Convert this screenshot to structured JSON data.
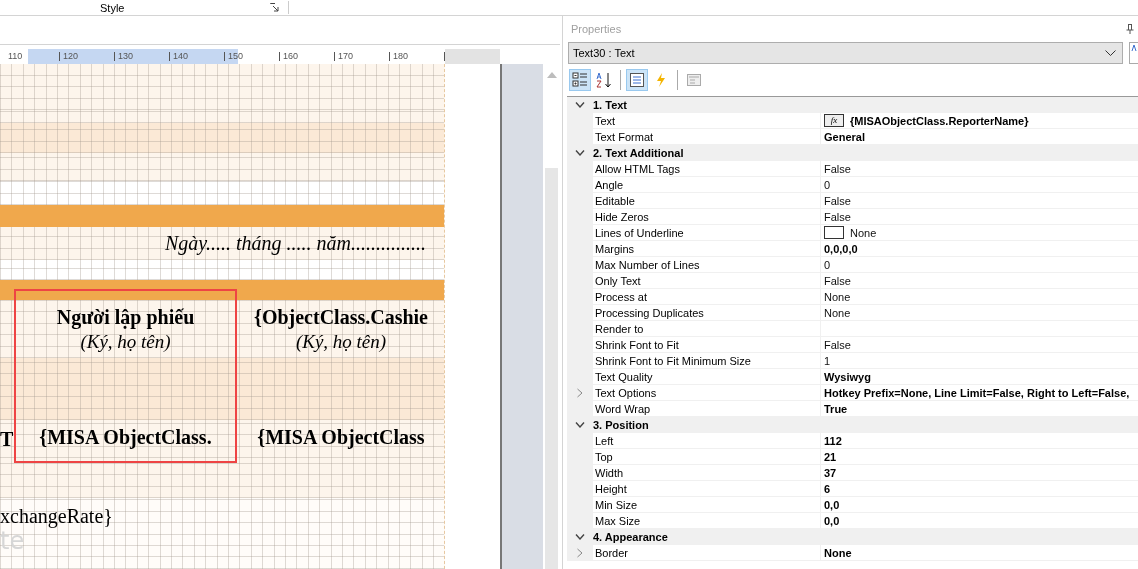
{
  "ribbon": {
    "group_label": "Style"
  },
  "ruler": {
    "ticks": [
      "110",
      "120",
      "130",
      "140",
      "150",
      "160",
      "170",
      "180"
    ]
  },
  "report": {
    "date_line": "Ngày..... tháng ..... năm...............",
    "signatures": [
      {
        "title": "Người lập phiếu",
        "note": "(Ký, họ tên)",
        "field": "{MISA ObjectClass.",
        "selected": true
      },
      {
        "title": "{ObjectClass.Cashie",
        "note": "(Ký, họ tên)",
        "field": "{MISA ObjectClass",
        "selected": false
      }
    ],
    "left_field": "T",
    "exchange_rate": "xchangeRate}",
    "faded_label": "te"
  },
  "properties": {
    "title": "Properties",
    "object_selector": "Text30 : Text",
    "toolbar": [
      {
        "kind": "categorized",
        "selected": true
      },
      {
        "kind": "alphabetical",
        "selected": false
      },
      {
        "kind": "separator"
      },
      {
        "kind": "properties",
        "selected": true
      },
      {
        "kind": "events",
        "selected": false
      },
      {
        "kind": "separator"
      },
      {
        "kind": "pages",
        "selected": false
      }
    ],
    "categories": [
      {
        "name": "1. Text",
        "expanded": true,
        "rows": [
          {
            "name": "Text",
            "value": "{MISAObjectClass.ReporterName}",
            "modified": true,
            "kind": "expression",
            "button_label": "fx",
            "expandable": false
          },
          {
            "name": "Text Format",
            "value": "General",
            "modified": true,
            "kind": "plain",
            "expandable": false
          }
        ]
      },
      {
        "name": "2. Text  Additional",
        "expanded": true,
        "rows": [
          {
            "name": "Allow HTML Tags",
            "value": "False",
            "modified": false,
            "kind": "plain",
            "expandable": false
          },
          {
            "name": "Angle",
            "value": "0",
            "modified": false,
            "kind": "plain",
            "expandable": false
          },
          {
            "name": "Editable",
            "value": "False",
            "modified": false,
            "kind": "plain",
            "expandable": false
          },
          {
            "name": "Hide Zeros",
            "value": "False",
            "modified": false,
            "kind": "plain",
            "expandable": false
          },
          {
            "name": "Lines of Underline",
            "value": "None",
            "modified": false,
            "kind": "swatch",
            "expandable": false
          },
          {
            "name": "Margins",
            "value": "0,0,0,0",
            "modified": true,
            "kind": "plain",
            "expandable": false
          },
          {
            "name": "Max Number of Lines",
            "value": "0",
            "modified": false,
            "kind": "plain",
            "expandable": false
          },
          {
            "name": "Only Text",
            "value": "False",
            "modified": false,
            "kind": "plain",
            "expandable": false
          },
          {
            "name": "Process at",
            "value": "None",
            "modified": false,
            "kind": "plain",
            "expandable": false
          },
          {
            "name": "Processing Duplicates",
            "value": "None",
            "modified": false,
            "kind": "plain",
            "expandable": false
          },
          {
            "name": "Render to",
            "kind": "plain",
            "expandable": false
          },
          {
            "name": "Shrink Font to Fit",
            "value": "False",
            "modified": false,
            "kind": "plain",
            "expandable": false
          },
          {
            "name": "Shrink Font to Fit Minimum Size",
            "value": "1",
            "modified": false,
            "kind": "plain",
            "expandable": false
          },
          {
            "name": "Text Quality",
            "value": "Wysiwyg",
            "modified": true,
            "kind": "plain",
            "expandable": false
          },
          {
            "name": "Text Options",
            "value": "Hotkey Prefix=None, Line Limit=False, Right to Left=False,",
            "modified": true,
            "kind": "plain",
            "expandable": true
          },
          {
            "name": "Word Wrap",
            "value": "True",
            "modified": true,
            "kind": "plain",
            "expandable": false
          }
        ]
      },
      {
        "name": "3. Position",
        "expanded": true,
        "rows": [
          {
            "name": "Left",
            "value": "112",
            "modified": true,
            "kind": "plain",
            "expandable": false
          },
          {
            "name": "Top",
            "value": "21",
            "modified": true,
            "kind": "plain",
            "expandable": false
          },
          {
            "name": "Width",
            "value": "37",
            "modified": true,
            "kind": "plain",
            "expandable": false
          },
          {
            "name": "Height",
            "value": "6",
            "modified": true,
            "kind": "plain",
            "expandable": false
          },
          {
            "name": "Min Size",
            "value": "0,0",
            "modified": true,
            "kind": "plain",
            "expandable": false
          },
          {
            "name": "Max Size",
            "value": "0,0",
            "modified": true,
            "kind": "plain",
            "expandable": false
          }
        ]
      },
      {
        "name": "4. Appearance",
        "expanded": true,
        "rows": [
          {
            "name": "Border",
            "value": "None",
            "modified": true,
            "kind": "plain",
            "expandable": true
          }
        ]
      }
    ]
  }
}
